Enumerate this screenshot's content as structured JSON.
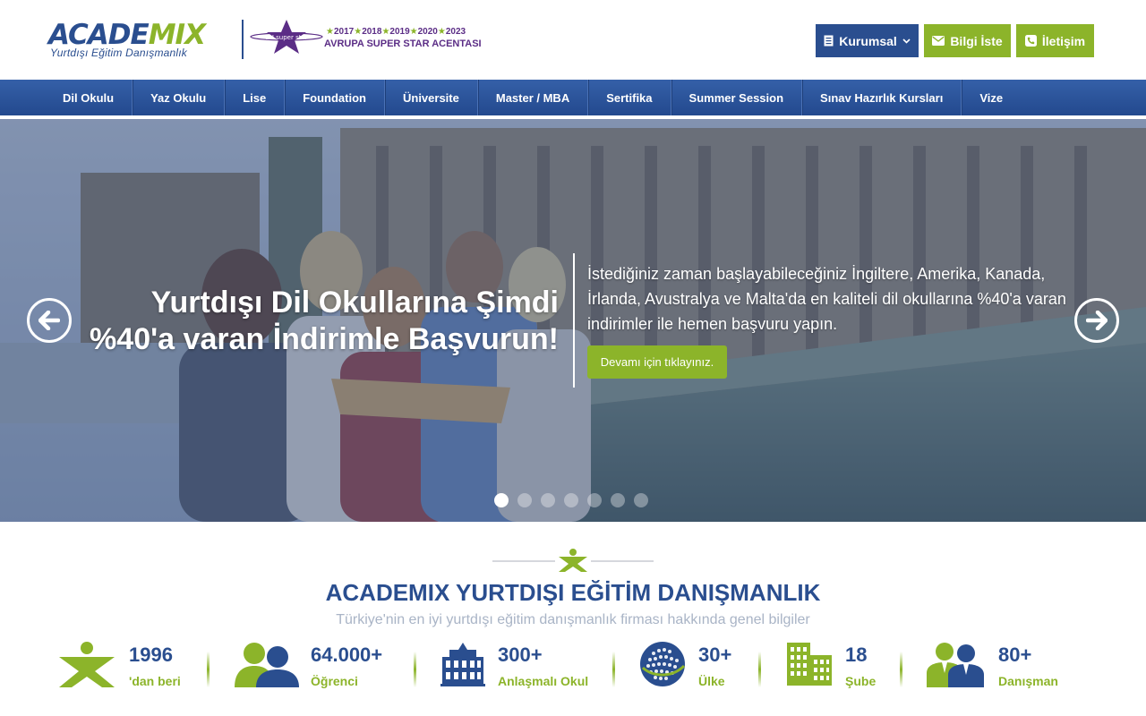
{
  "header": {
    "logo_text_part1": "ACADE",
    "logo_text_part2": "MIX",
    "logo_subtitle": "Yurtdışı Eğitim Danışmanlık",
    "award_badge_text": "EU super star",
    "award_years": [
      "2017",
      "2018",
      "2019",
      "2020",
      "2023"
    ],
    "award_title": "AVRUPA SUPER STAR ACENTASI",
    "buttons": {
      "kurumsal": "Kurumsal",
      "bilgi_iste": "Bilgi İste",
      "iletisim": "İletişim"
    }
  },
  "nav": {
    "items": [
      {
        "label": "Dil Okulu"
      },
      {
        "label": "Yaz Okulu"
      },
      {
        "label": "Lise"
      },
      {
        "label": "Foundation"
      },
      {
        "label": "Üniversite"
      },
      {
        "label": "Master / MBA"
      },
      {
        "label": "Sertifika"
      },
      {
        "label": "Summer Session"
      },
      {
        "label": "Sınav Hazırlık Kursları"
      },
      {
        "label": "Vize"
      }
    ]
  },
  "hero": {
    "title_line1": "Yurtdışı Dil Okullarına Şimdi",
    "title_line2": "%40'a varan İndirimle Başvurun!",
    "description": "İstediğiniz zaman başlayabileceğiniz İngiltere, Amerika, Kanada, İrlanda, Avustralya ve Malta'da en kaliteli dil okullarına %40'a varan indirimler ile hemen başvuru yapın.",
    "cta_label": "Devamı için tıklayınız.",
    "slide_count": 7,
    "active_slide": 1
  },
  "intro": {
    "title": "ACADEMIX YURTDIŞI EĞİTİM DANIŞMANLIK",
    "subtitle": "Türkiye'nin en iyi yurtdışı eğitim danışmanlık firması hakkında genel bilgiler"
  },
  "stats": [
    {
      "icon": "academix-x-icon",
      "value": "1996",
      "label": "'dan beri"
    },
    {
      "icon": "students-icon",
      "value": "64.000+",
      "label": "Öğrenci"
    },
    {
      "icon": "school-building-icon",
      "value": "300+",
      "label": "Anlaşmalı Okul"
    },
    {
      "icon": "globe-icon",
      "value": "30+",
      "label": "Ülke"
    },
    {
      "icon": "office-buildings-icon",
      "value": "18",
      "label": "Şube"
    },
    {
      "icon": "consultants-icon",
      "value": "80+",
      "label": "Danışman"
    }
  ],
  "colors": {
    "brand_blue": "#2a4e8f",
    "brand_green": "#8cb42a",
    "award_purple": "#5b2d86"
  }
}
